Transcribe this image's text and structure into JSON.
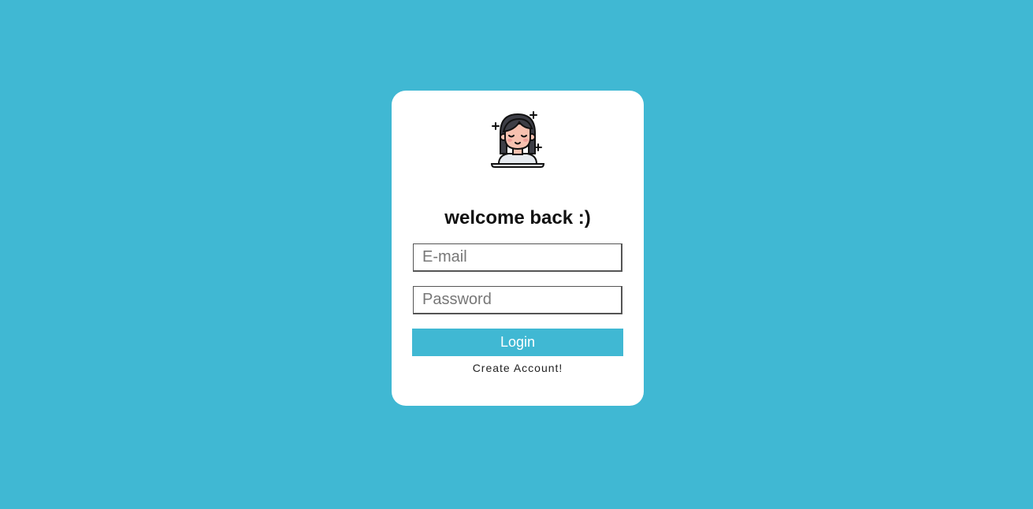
{
  "login_card": {
    "avatar_icon": "meditating-girl-icon",
    "title": "welcome back :)",
    "email_placeholder": "E-mail",
    "password_placeholder": "Password",
    "login_label": "Login",
    "create_account_label": "Create Account!"
  },
  "colors": {
    "background": "#40b8d3",
    "card": "#ffffff",
    "button": "#40b8d3",
    "button_text": "#ffffff"
  }
}
